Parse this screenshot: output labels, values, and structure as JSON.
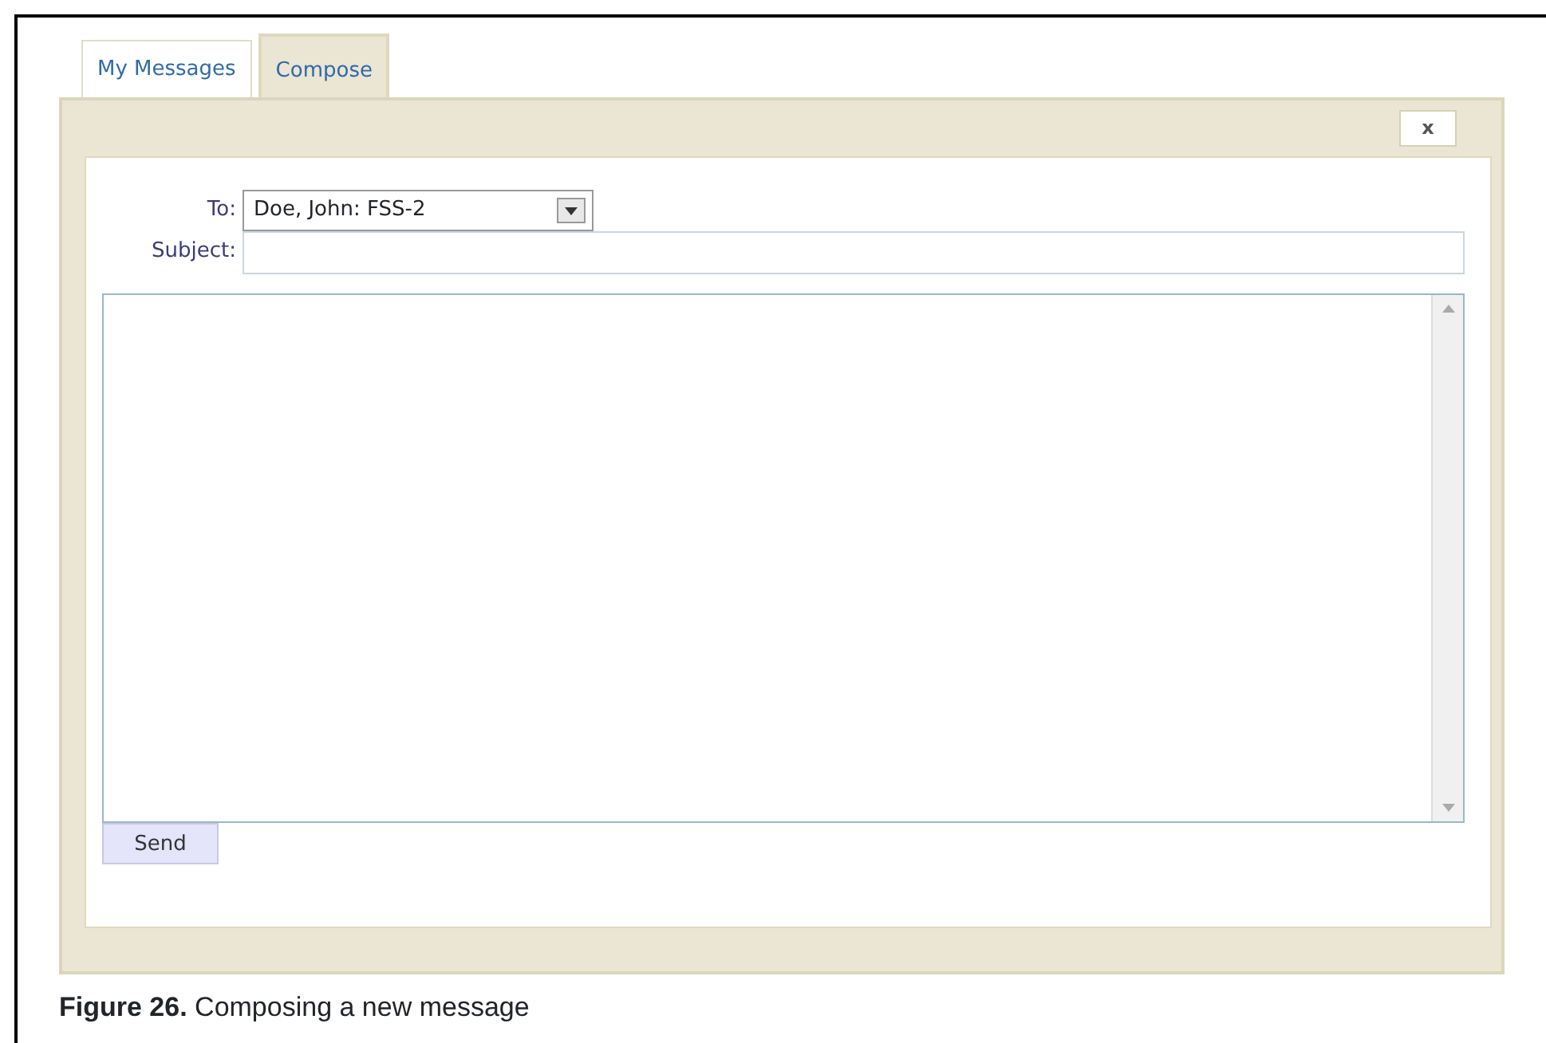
{
  "tabs": [
    {
      "label": "My Messages",
      "selected": false
    },
    {
      "label": "Compose",
      "selected": true
    }
  ],
  "close_button": {
    "label": "x"
  },
  "form": {
    "to_label": "To:",
    "to_value": "Doe, John: FSS-2",
    "subject_label": "Subject:"
  },
  "send_button": {
    "label": "Send"
  },
  "caption": "**Figure 26.** Composing a new message"
}
